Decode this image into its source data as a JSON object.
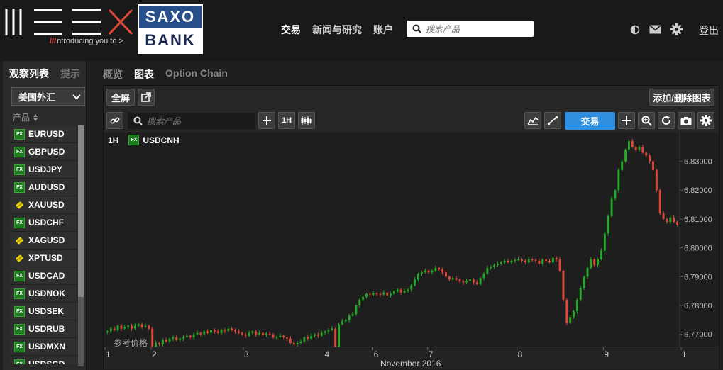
{
  "topbar": {
    "mex_logo_tagline": "ntroducing you to",
    "saxo_top": "SAXO",
    "saxo_bottom": "BANK",
    "nav": [
      "交易",
      "新闻与研究",
      "账户"
    ],
    "search_placeholder": "搜索产品",
    "logout": "登出"
  },
  "watchlist": {
    "tabs": [
      "观察列表",
      "提示"
    ],
    "selected_list": "美国外汇",
    "column_header": "产品",
    "items": [
      {
        "symbol": "EURUSD",
        "type": "FX"
      },
      {
        "symbol": "GBPUSD",
        "type": "FX"
      },
      {
        "symbol": "USDJPY",
        "type": "FX"
      },
      {
        "symbol": "AUDUSD",
        "type": "FX"
      },
      {
        "symbol": "XAUUSD",
        "type": "metal"
      },
      {
        "symbol": "USDCHF",
        "type": "FX"
      },
      {
        "symbol": "XAGUSD",
        "type": "metal"
      },
      {
        "symbol": "XPTUSD",
        "type": "metal"
      },
      {
        "symbol": "USDCAD",
        "type": "FX"
      },
      {
        "symbol": "USDNOK",
        "type": "FX"
      },
      {
        "symbol": "USDSEK",
        "type": "FX"
      },
      {
        "symbol": "USDRUB",
        "type": "FX"
      },
      {
        "symbol": "USDMXN",
        "type": "FX"
      },
      {
        "symbol": "USDSGD",
        "type": "FX"
      }
    ]
  },
  "main": {
    "tabs": [
      "概览",
      "图表",
      "Option Chain"
    ],
    "active_tab": "图表",
    "fullscreen": "全屏",
    "add_remove_chart": "添加/删除图表",
    "chart_search_placeholder": "搜索产品",
    "interval_button": "1H",
    "trade_button": "交易"
  },
  "chart_data": {
    "type": "candlestick",
    "interval": "1H",
    "instrument": "USDCNH",
    "instrument_badge": "FX",
    "footer_label": "参考价格",
    "month_label": "November 2016",
    "x_tick_labels": [
      "1",
      "2",
      "3",
      "4",
      "6",
      "7",
      "8",
      "9",
      "1"
    ],
    "y_tick_labels": [
      "6.83000",
      "6.82000",
      "6.81000",
      "6.80000",
      "6.79000",
      "6.78000",
      "6.77000"
    ],
    "ylim": [
      6.7655,
      6.8375
    ],
    "candles_close": [
      6.771,
      6.772,
      6.7715,
      6.773,
      6.772,
      6.7725,
      6.773,
      6.772,
      6.773,
      6.7735,
      6.7725,
      6.773,
      6.772,
      6.7655,
      6.767,
      6.7665,
      6.768,
      6.7675,
      6.7685,
      6.769,
      6.768,
      6.7685,
      6.769,
      6.7695,
      6.769,
      6.77,
      6.7705,
      6.77,
      6.771,
      6.7705,
      6.7715,
      6.771,
      6.7705,
      6.7715,
      6.7712,
      6.772,
      6.7715,
      6.771,
      6.7705,
      6.77,
      6.7695,
      6.7705,
      6.771,
      6.77,
      6.7705,
      6.7698,
      6.7702,
      6.77,
      6.769,
      6.769,
      6.7695,
      6.769,
      6.7685,
      6.767,
      6.7665,
      6.767,
      6.7675,
      6.769,
      6.7685,
      6.7695,
      6.77,
      6.7695,
      6.7705,
      6.771,
      6.7715,
      6.772,
      6.765,
      6.7735,
      6.7745,
      6.775,
      6.7765,
      6.777,
      6.78,
      6.782,
      6.783,
      6.784,
      6.7838,
      6.7842,
      6.784,
      6.7838,
      6.7845,
      6.7835,
      6.784,
      6.785,
      6.7855,
      6.7845,
      6.785,
      6.7855,
      6.787,
      6.789,
      6.791,
      6.7915,
      6.792,
      6.7915,
      6.792,
      6.793,
      6.7925,
      6.7915,
      6.79,
      6.789,
      6.7895,
      6.789,
      6.7885,
      6.788,
      6.7885,
      6.789,
      6.788,
      6.7875,
      6.7895,
      6.791,
      6.793,
      6.7935,
      6.794,
      6.7945,
      6.795,
      6.7955,
      6.795,
      6.7955,
      6.7958,
      6.796,
      6.7955,
      6.795,
      6.796,
      6.7958,
      6.7955,
      6.7945,
      6.796,
      6.7955,
      6.795,
      6.7965,
      6.796,
      6.792,
      6.782,
      6.774,
      6.776,
      6.778,
      6.782,
      6.786,
      6.79,
      6.793,
      6.796,
      6.794,
      6.796,
      6.799,
      6.805,
      6.811,
      6.817,
      6.82,
      6.827,
      6.83,
      6.834,
      6.837,
      6.835,
      6.834,
      6.835,
      6.833,
      6.832,
      6.83,
      6.827,
      6.82,
      6.812,
      6.81,
      6.809,
      6.8105,
      6.809,
      6.808
    ]
  }
}
